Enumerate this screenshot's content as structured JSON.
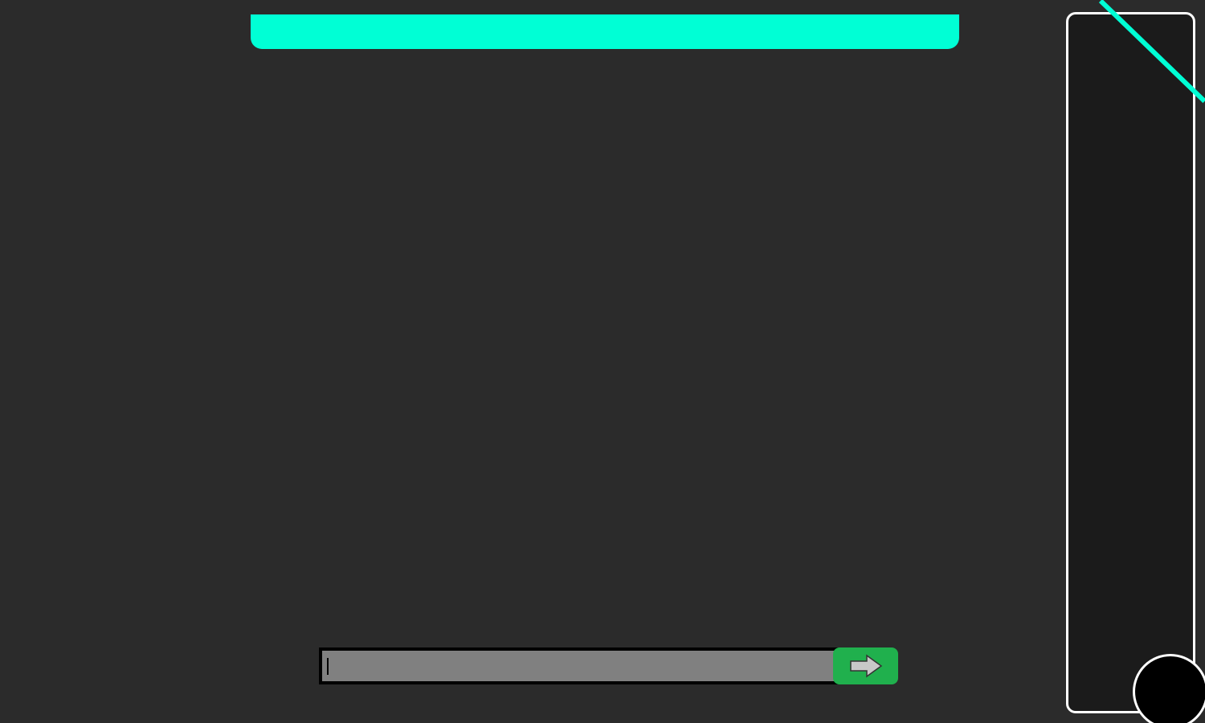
{
  "header": {
    "title": ""
  },
  "chat": {
    "input_value": "",
    "input_placeholder": "",
    "send_icon": "arrow-right-icon"
  },
  "colors": {
    "background": "#2b2b2b",
    "accent": "#00ffd5",
    "panel": "#1b1b1b",
    "send_button": "#20b04d",
    "input_bg": "#808080"
  }
}
